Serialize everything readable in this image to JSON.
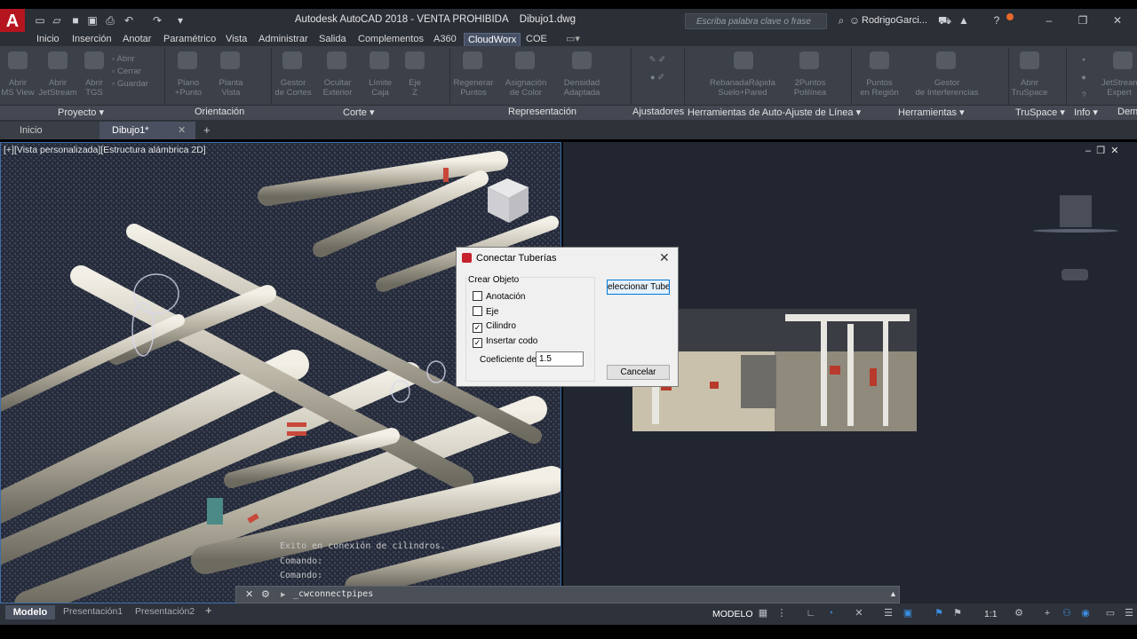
{
  "app": {
    "logo": "A",
    "title": "Autodesk AutoCAD 2018 - VENTA PROHIBIDA    Dibujo1.dwg",
    "search_placeholder": "Escriba palabra clave o frase",
    "user": "RodrigoGarci...",
    "qat_icons": [
      "new-icon",
      "open-icon",
      "save-icon",
      "saveas-icon",
      "print-icon",
      "undo-icon",
      "redo-icon"
    ]
  },
  "ribbon": {
    "tabs": [
      "Inicio",
      "Inserción",
      "Anotar",
      "Paramétrico",
      "Vista",
      "Administrar",
      "Salida",
      "Complementos",
      "A360",
      "CloudWorx",
      "COE"
    ],
    "active_tab": "CloudWorx",
    "tools": [
      "Abrir",
      "Abrir",
      "Abrir",
      "Abrir",
      "Plano",
      "Planta",
      "Gestor",
      "Ocultar",
      "Límite",
      "Eje",
      "Regenerar",
      "Asignación",
      "Densidad",
      "RebanadaRápida",
      "2Puntos",
      "Puntos",
      "Gestor",
      "Abrir",
      "JetStream"
    ],
    "tools_row2": [
      "MS View",
      "JetStream",
      "TGS",
      "",
      "Plano",
      "Vista",
      "de Cortes",
      "Exterior",
      "Caja",
      "Z",
      "Puntos",
      "de Color",
      "Adaptada",
      "Suelo+Pared",
      "Polilínea",
      "en Región",
      "de Interferencias",
      "TruSpace",
      "Expert"
    ],
    "panels": [
      "Proyecto",
      "Orientación",
      "Corte",
      "Representación",
      "Ajustadores",
      "Herramientas de Auto-Ajuste de Línea",
      "Herramientas",
      "TruSpace",
      "Info",
      "Dem"
    ]
  },
  "file_tabs": {
    "home": "Inicio",
    "drawing": "Dibujo1*"
  },
  "viewport_label": "[+][Vista personalizada][Estructura alámbrica 2D]",
  "dialog": {
    "title": "Conectar Tuberías",
    "group": "Crear Objeto",
    "options": [
      {
        "label": "Anotación",
        "checked": false
      },
      {
        "label": "Eje",
        "checked": false
      },
      {
        "label": "Cilindro",
        "checked": true
      },
      {
        "label": "Insertar codo",
        "checked": true
      }
    ],
    "coef_label": "Coeficiente de",
    "coef_value": "1.5",
    "select_button": "eleccionar Tuberí",
    "cancel_button": "Cancelar"
  },
  "command": {
    "history": [
      "Exito en conexión de cilindros.",
      "Comando:",
      "Comando:"
    ],
    "current": "_cwconnectpipes"
  },
  "status": {
    "layout_tabs": [
      "Modelo",
      "Presentación1",
      "Presentación2"
    ],
    "modelo_button": "MODELO",
    "scale": "1:1"
  }
}
